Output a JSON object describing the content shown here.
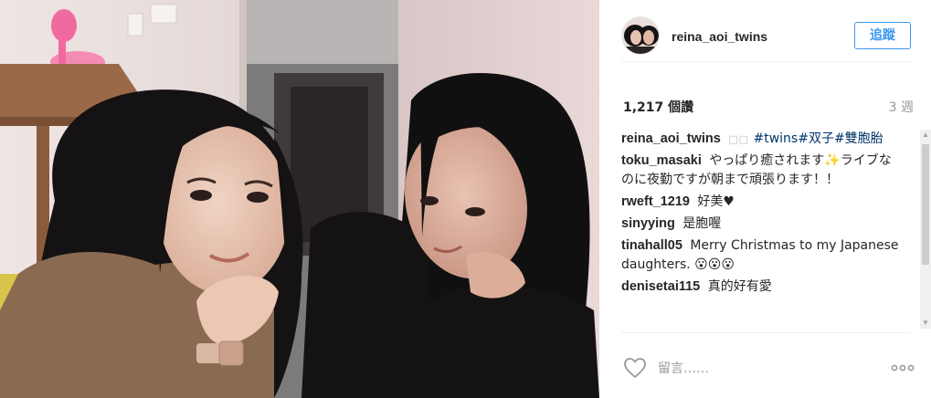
{
  "post": {
    "username": "reina_aoi_twins",
    "follow_label": "追蹤",
    "likes": "1,217 個讚",
    "age": "3 週"
  },
  "comments": [
    {
      "user": "reina_aoi_twins",
      "prefix": "□□",
      "text": "#twins#双子#雙胞胎"
    },
    {
      "user": "toku_masaki",
      "text": "やっぱり癒されます✨ライブなのに夜勤ですが朝まで頑張ります！！"
    },
    {
      "user": "rweft_1219",
      "text": "好美♥"
    },
    {
      "user": "sinyying",
      "text": "是胞喔"
    },
    {
      "user": "tinahall05",
      "text": "Merry Christmas to my Japanese daughters. 😮😮😮"
    },
    {
      "user": "denisetai115",
      "text": "真的好有愛"
    }
  ],
  "footer": {
    "comment_placeholder": "留言……"
  },
  "icons": {
    "like": "heart-outline-icon",
    "options": "more-options-icon",
    "scroll_up": "scroll-up-arrow-icon",
    "scroll_down": "scroll-down-arrow-icon"
  }
}
